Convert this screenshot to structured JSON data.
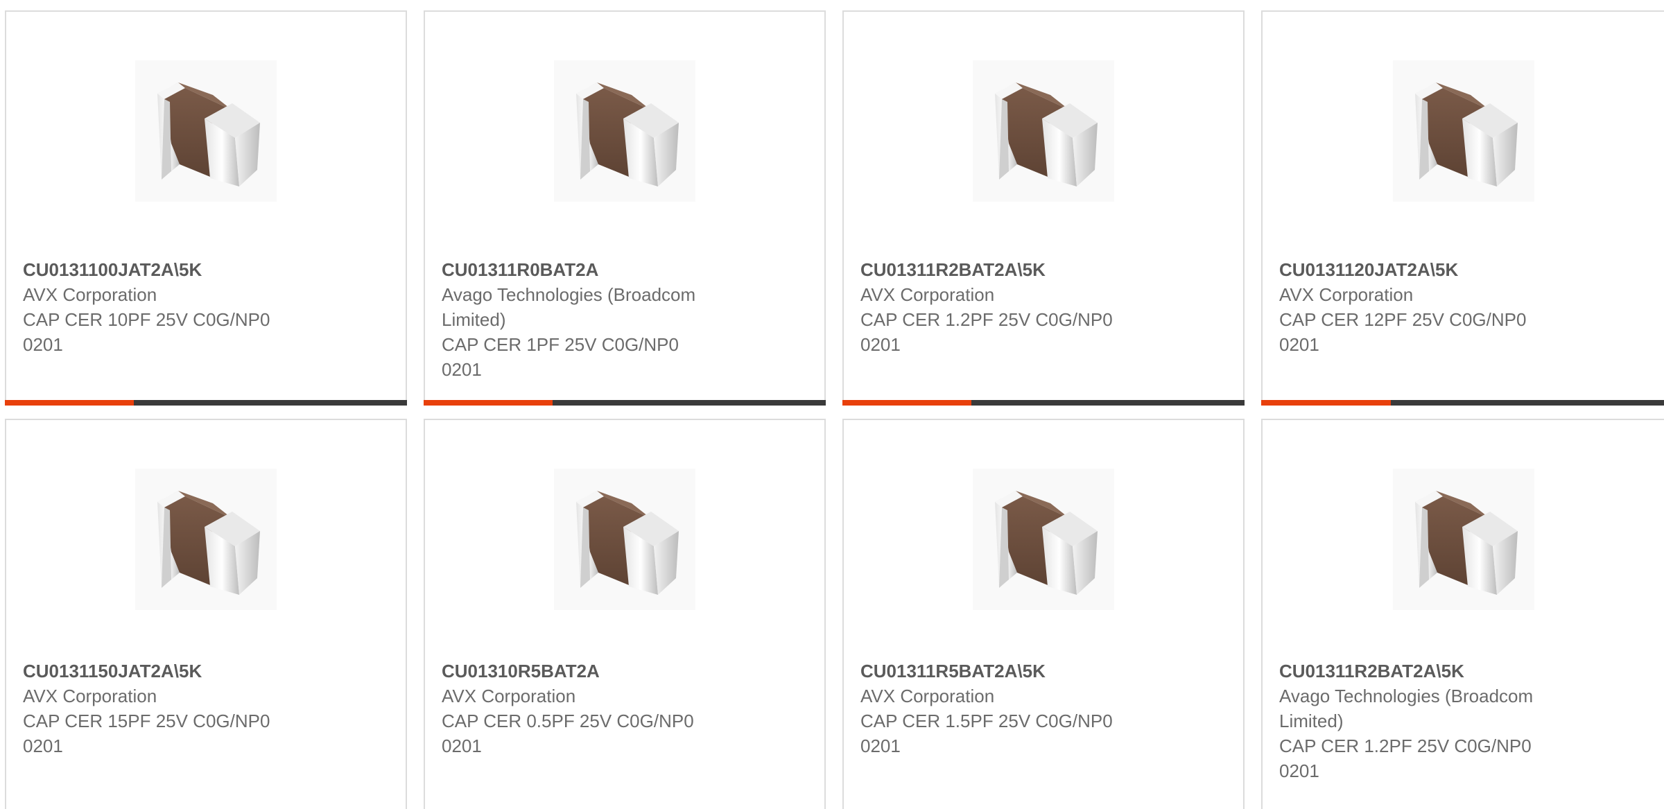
{
  "colors": {
    "accent": "#e8400c",
    "bar_track": "#3a3a3a",
    "card_border": "#dcdcdc",
    "text": "#6b6b6b"
  },
  "product_image": {
    "icon": "ceramic-capacitor-chip-image"
  },
  "products": [
    {
      "part": "CU0131100JAT2A\\5K",
      "manufacturer": "AVX Corporation",
      "description": "CAP CER 10PF 25V C0G/NP0 0201",
      "progress_fraction": 0.32
    },
    {
      "part": "CU01311R0BAT2A",
      "manufacturer": "Avago Technologies (Broadcom Limited)",
      "description": "CAP CER 1PF 25V C0G/NP0 0201",
      "progress_fraction": 0.32
    },
    {
      "part": "CU01311R2BAT2A\\5K",
      "manufacturer": "AVX Corporation",
      "description": "CAP CER 1.2PF 25V C0G/NP0 0201",
      "progress_fraction": 0.32
    },
    {
      "part": "CU0131120JAT2A\\5K",
      "manufacturer": "AVX Corporation",
      "description": "CAP CER 12PF 25V C0G/NP0 0201",
      "progress_fraction": 0.32
    },
    {
      "part": "CU0131150JAT2A\\5K",
      "manufacturer": "AVX Corporation",
      "description": "CAP CER 15PF 25V C0G/NP0 0201",
      "progress_fraction": null
    },
    {
      "part": "CU01310R5BAT2A",
      "manufacturer": "AVX Corporation",
      "description": "CAP CER 0.5PF 25V C0G/NP0 0201",
      "progress_fraction": null
    },
    {
      "part": "CU01311R5BAT2A\\5K",
      "manufacturer": "AVX Corporation",
      "description": "CAP CER 1.5PF 25V C0G/NP0 0201",
      "progress_fraction": null
    },
    {
      "part": "CU01311R2BAT2A\\5K",
      "manufacturer": "Avago Technologies (Broadcom Limited)",
      "description": "CAP CER 1.2PF 25V C0G/NP0 0201",
      "progress_fraction": null
    }
  ]
}
